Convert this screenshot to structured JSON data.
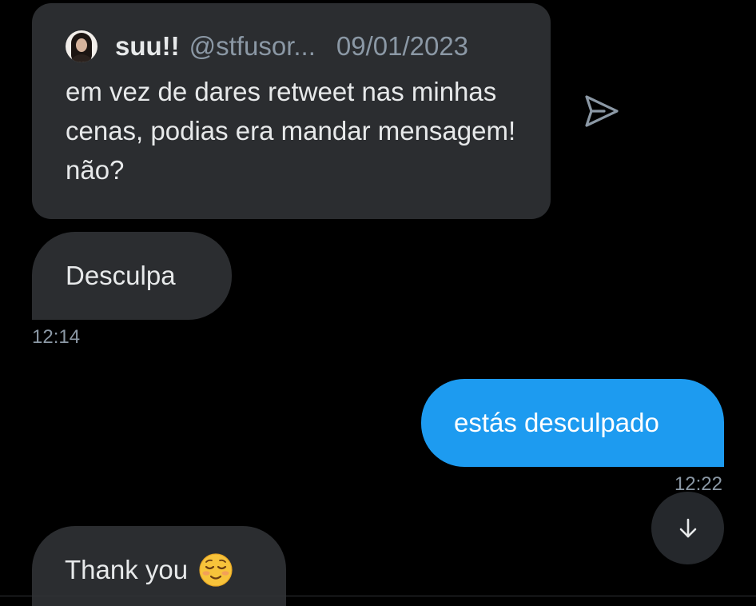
{
  "quote": {
    "display_name": "suu!!",
    "handle": "@stfusor...",
    "date": "09/01/2023",
    "text": "em vez de dares retweet nas minhas cenas, podias era mandar mensagem! não?"
  },
  "messages": [
    {
      "direction": "received",
      "text": "Desculpa",
      "time": "12:14"
    },
    {
      "direction": "sent",
      "text": "estás desculpado",
      "time": "12:22"
    },
    {
      "direction": "received",
      "text": "Thank you"
    }
  ],
  "icons": {
    "share": "send-icon",
    "scroll": "arrow-down-icon",
    "emoji": "relieved-face-emoji"
  },
  "colors": {
    "background": "#000000",
    "received_bubble": "#2b2d30",
    "sent_bubble": "#1d9bf0",
    "secondary_text": "#8b98a5"
  }
}
